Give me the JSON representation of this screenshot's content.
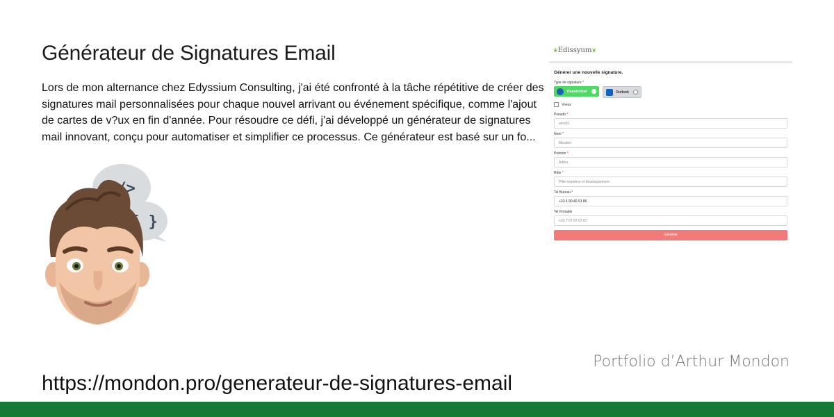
{
  "title": "Générateur de Signatures Email",
  "description": "Lors de mon alternance chez Edyssium Consulting, j'ai été confronté à la tâche répétitive de créer des signatures mail personnalisées pour chaque nouvel arrivant ou événement spécifique, comme l'ajout de cartes de v?ux en fin d'année. Pour résoudre ce défi, j'ai développé un générateur de signatures mail innovant, conçu pour automatiser et simplifier ce processus.     Ce générateur est basé sur un fo...",
  "url": "https://mondon.pro/generateur-de-signatures-email",
  "portfolio_label": "Portfolio d’Arthur Mondon",
  "colors": {
    "bottom_bar": "#157a34",
    "generate_button": "#f47a7a",
    "thunderbird_selected": "#4cd964"
  },
  "avatar": {
    "bubble_top_icon": "</>",
    "bubble_bottom_icon": "{ }"
  },
  "screenshot": {
    "logo": "Edissyum",
    "heading": "Générer une nouvelle signature.",
    "type_label": "Type de signature",
    "required_mark": "*",
    "type_options": [
      {
        "label": "Thunderbird",
        "icon": "thunderbird-icon",
        "selected": true
      },
      {
        "label": "Outlook",
        "icon": "outlook-icon",
        "selected": false
      }
    ],
    "voeux_label": "Voeux",
    "fields": [
      {
        "label": "Pseudo",
        "required": "*",
        "value": "amo01",
        "filled": false
      },
      {
        "label": "Nom",
        "required": "*",
        "value": "Mondon",
        "filled": false
      },
      {
        "label": "Prénom",
        "required": "*",
        "value": "Arthur",
        "filled": false
      },
      {
        "label": "Rôle",
        "required": "*",
        "value": "Pôle expertise et développement",
        "filled": false
      },
      {
        "label": "Tel Bureau",
        "required": "*",
        "value": "+33 4 90 40 91 86",
        "filled": true
      },
      {
        "label": "Tel Portable",
        "required": "",
        "value": "+33 7 07 07 07 07",
        "filled": false
      }
    ],
    "generate_label": "Générer"
  }
}
